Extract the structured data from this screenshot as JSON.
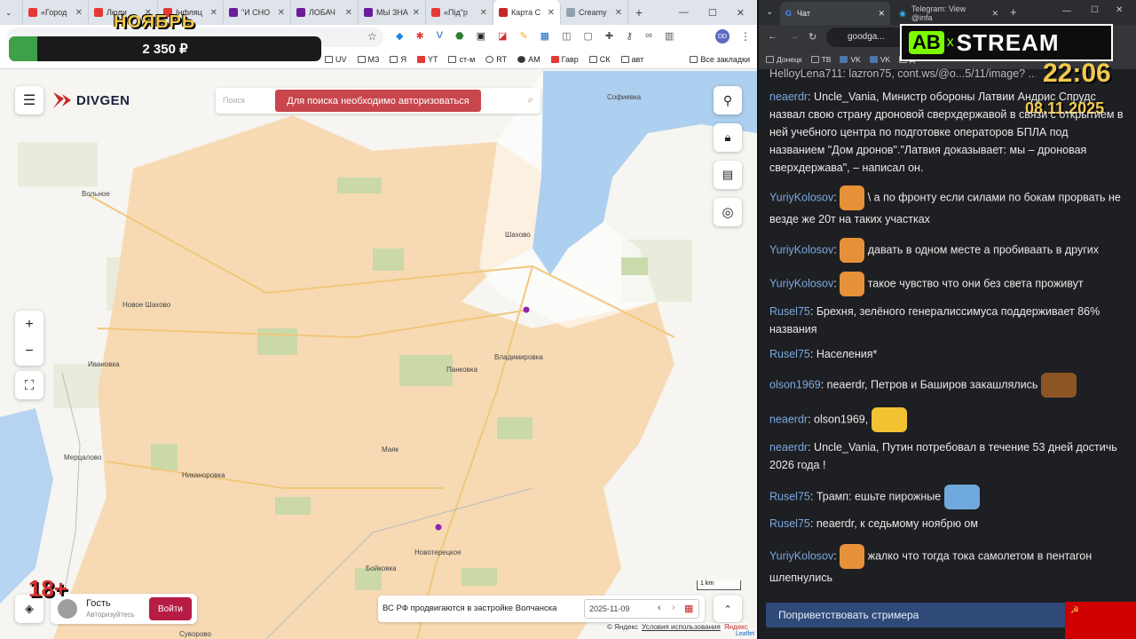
{
  "left_browser": {
    "tabs": [
      "«Город",
      "Люди",
      "Інфляц",
      "\"И СНО",
      "ЛОБАЧ",
      "МЫ ЗНА",
      "«Під\"р",
      "Карта С",
      "Creamy"
    ],
    "bookmarks": [
      "UV",
      "МЗ",
      "Я",
      "YT",
      "ст-м",
      "RT",
      "АМ",
      "Гавр",
      "СК",
      "авт",
      "Все закладки"
    ]
  },
  "overlay": {
    "month": "НОЯБРЬ",
    "amount": "2 350 ₽",
    "age": "18+",
    "progress_fraction": 0.09
  },
  "map": {
    "brand": "DIVGEN",
    "search_placeholder": "Поиск",
    "search_notice": "Для поиска необходимо авторизоваться",
    "zoom_in": "+",
    "zoom_out": "−",
    "user_name": "Гость",
    "user_status": "Авторизуйтесь",
    "login_button": "Войти",
    "event_title": "ВС РФ продвигаются в застройке Волчанска",
    "event_date": "2025-11-09",
    "scale": "1 km",
    "attribution": "© Яндекс",
    "terms": "Условия использования",
    "yandex": "Яндекс",
    "leaflet": "Leaflet",
    "towns": [
      "Софиевка",
      "Вольное",
      "Шахово",
      "Новое Шахово",
      "Ивановка",
      "Владимировка",
      "Панковка",
      "Мерцалово",
      "Маяк",
      "Никаноровка",
      "Новотерецкое",
      "Бойковка",
      "Суворово"
    ]
  },
  "right_browser": {
    "tab_chat": "Чат",
    "tab_telegram": "Telegram: View @infa",
    "address": "goodga...",
    "bookmarks": [
      "Донецк",
      "ТВ",
      "VK",
      "VK",
      "Д"
    ],
    "stream_logo_left": "AB",
    "stream_logo_x": "x",
    "stream_logo_right": "STREAM",
    "clock": "22:06",
    "date": "08.11.2025"
  },
  "chat": {
    "top_line": "HelloyLena711: lazron75, cont.ws/@o...5/11/image? ...",
    "messages": [
      {
        "user": "neaerdr",
        "text": "Uncle_Vania, Министр обороны Латвии Андрис Спрудс назвал свою страну дроновой сверхдержавой в связи с открытием в ней учебного центра по подготовке операторов БПЛА под названием \"Дом дронов\".\"Латвия доказывает: мы – дроновая сверхдержава\", – написал он."
      },
      {
        "user": "YuriyKolosov",
        "text": "\\ а по фронту если силами по бокам прорвать не везде же 20т на таких участках"
      },
      {
        "user": "YuriyKolosov",
        "text": "давать в одном месте а пробиваать в других"
      },
      {
        "user": "YuriyKolosov",
        "text": "такое чувство что они без света проживут"
      },
      {
        "user": "Rusel75",
        "text": "Брехня, зелёного генералиссимуса поддерживает 86% названия"
      },
      {
        "user": "Rusel75",
        "text": "Населения*"
      },
      {
        "user": "olson1969",
        "text": "neaerdr, Петров и Баширов закашлялись"
      },
      {
        "user": "neaerdr",
        "text": "olson1969,"
      },
      {
        "user": "neaerdr",
        "text": "Uncle_Vania, Путин потребовал в течение 53 дней достичь 2026 года !"
      },
      {
        "user": "Rusel75",
        "text": "Трамп: ешьте пирожные"
      },
      {
        "user": "Rusel75",
        "text": "neaerdr, к седьмому ноябрю  ом"
      },
      {
        "user": "YuriyKolosov",
        "text": "жалко что тогда тока самолетом в пентагон шлепнулись"
      }
    ],
    "greet_button": "Поприветствовать стримера"
  }
}
